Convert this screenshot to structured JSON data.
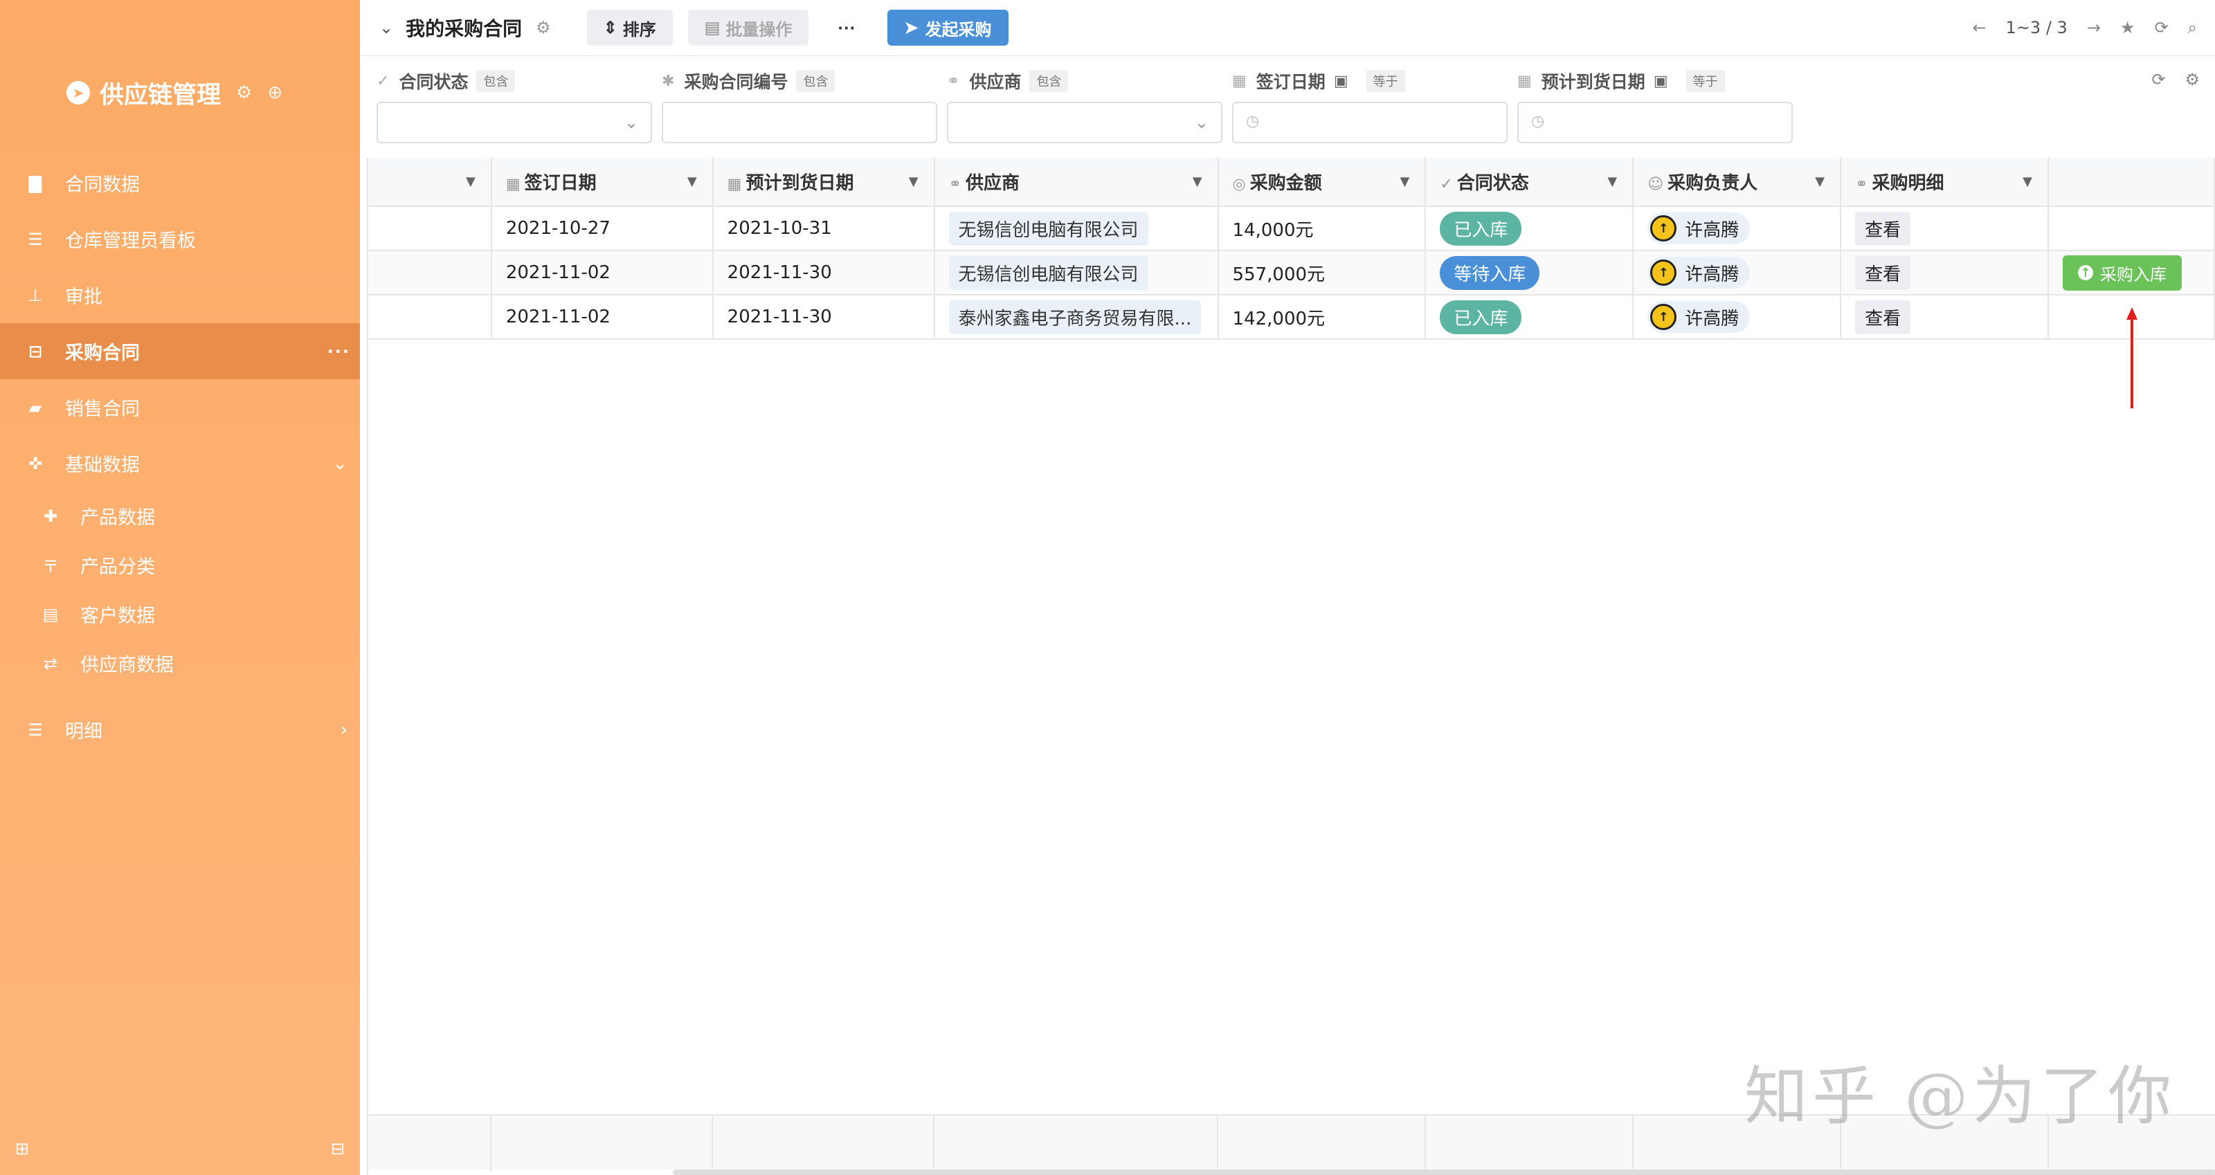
{
  "sidebar": {
    "brand_title": "供应链管理",
    "items": [
      {
        "label": "合同数据",
        "icon": "briefcase-icon"
      },
      {
        "label": "仓库管理员看板",
        "icon": "list-icon"
      },
      {
        "label": "审批",
        "icon": "stamp-icon"
      },
      {
        "label": "采购合同",
        "icon": "basket-icon",
        "active": true
      },
      {
        "label": "销售合同",
        "icon": "book-icon"
      },
      {
        "label": "基础数据",
        "icon": "crosshair-icon"
      }
    ],
    "sub_items": [
      {
        "label": "产品数据",
        "icon": "puzzle-icon"
      },
      {
        "label": "产品分类",
        "icon": "signpost-icon"
      },
      {
        "label": "客户数据",
        "icon": "id-card-icon"
      },
      {
        "label": "供应商数据",
        "icon": "exchange-icon"
      }
    ],
    "detail_item": {
      "label": "明细",
      "icon": "list-icon"
    }
  },
  "topbar": {
    "title": "我的采购合同",
    "sort_label": "排序",
    "batch_label": "批量操作",
    "more_label": "···",
    "launch_label": "发起采购",
    "pager": "1~3 / 3"
  },
  "filters": [
    {
      "label": "合同状态",
      "op": "包含",
      "type": "select"
    },
    {
      "label": "采购合同编号",
      "op": "包含",
      "type": "text"
    },
    {
      "label": "供应商",
      "op": "包含",
      "type": "select"
    },
    {
      "label": "签订日期",
      "op": "等于",
      "type": "date"
    },
    {
      "label": "预计到货日期",
      "op": "等于",
      "type": "date"
    }
  ],
  "table": {
    "columns": [
      "签订日期",
      "预计到货日期",
      "供应商",
      "采购金额",
      "合同状态",
      "采购负责人",
      "采购明细"
    ],
    "rows": [
      {
        "sign_date": "2021-10-27",
        "arrival_date": "2021-10-31",
        "supplier": "无锡信创电脑有限公司",
        "amount": "14,000元",
        "status": "已入库",
        "status_color": "#5bb5a2",
        "owner": "许高腾",
        "detail": "查看",
        "action": ""
      },
      {
        "sign_date": "2021-11-02",
        "arrival_date": "2021-11-30",
        "supplier": "无锡信创电脑有限公司",
        "amount": "557,000元",
        "status": "等待入库",
        "status_color": "#4a90d9",
        "owner": "许高腾",
        "detail": "查看",
        "action": "采购入库"
      },
      {
        "sign_date": "2021-11-02",
        "arrival_date": "2021-11-30",
        "supplier": "泰州家鑫电子商务贸易有限...",
        "amount": "142,000元",
        "status": "已入库",
        "status_color": "#5bb5a2",
        "owner": "许高腾",
        "detail": "查看",
        "action": ""
      }
    ]
  },
  "watermark": "知乎 @为了你",
  "colors": {
    "sidebar": "#fdab66",
    "accent_blue": "#4a90d9",
    "action_green": "#6ac259",
    "arrow_red": "#e02020"
  }
}
